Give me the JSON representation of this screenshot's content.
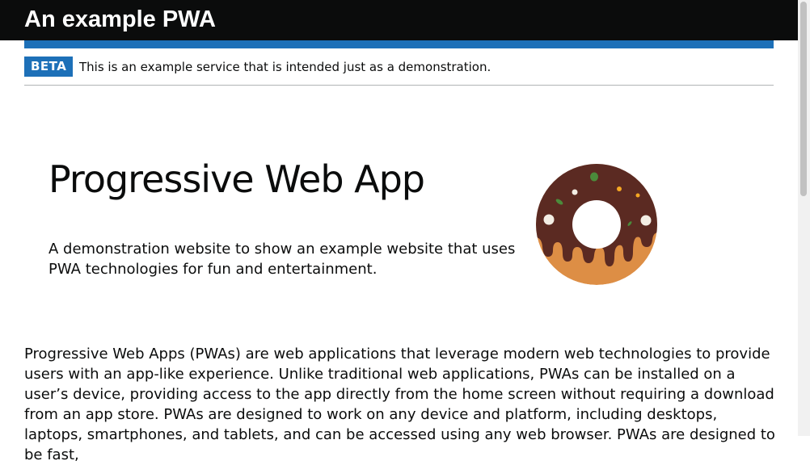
{
  "header": {
    "title": "An example PWA"
  },
  "phase_banner": {
    "tag": "BETA",
    "text": "This is an example service that is intended just as a demonstration."
  },
  "hero": {
    "title": "Progressive Web App",
    "description": "A demonstration website to show an example website that uses PWA technologies for fun and entertainment.",
    "image": "donut-illustration"
  },
  "main": {
    "paragraph": "Progressive Web Apps (PWAs) are web applications that leverage modern web technologies to provide users with an app-like experience. Unlike traditional web applications, PWAs can be installed on a user’s device, providing access to the app directly from the home screen without requiring a download from an app store. PWAs are designed to work on any device and platform, including desktops, laptops, smartphones, and tablets, and can be accessed using any web browser. PWAs are designed to be fast,"
  },
  "colors": {
    "header_bg": "#0b0c0c",
    "accent_blue": "#1d70b8",
    "donut_dough": "#dd8e45",
    "donut_icing": "#5b2a22"
  }
}
